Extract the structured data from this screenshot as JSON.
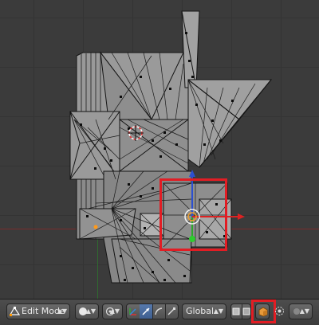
{
  "header": {
    "mode_label": "Edit Mode",
    "orientation_label": "Global"
  },
  "icons": {
    "editor_type": "blender-logo-icon",
    "mode": "edit-mode-icon",
    "shading": "solid-sphere-icon",
    "pivot": "pivot-point-icon",
    "manipulator": "manipulator-icon",
    "translate": "translate-icon",
    "rotate": "rotate-icon",
    "scale": "scale-icon",
    "vertex_select": "vertex-select-icon",
    "edge_select": "edge-select-icon",
    "limit_selection": "limit-selection-visible-icon",
    "proportional": "proportional-edit-icon"
  },
  "colors": {
    "highlight": "#e21d24",
    "x_axis": "#c62727",
    "manipulator_active": "#5679ad"
  }
}
